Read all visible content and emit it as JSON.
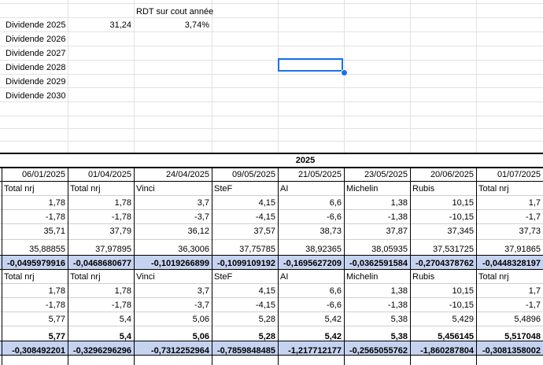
{
  "header": {
    "rdt_label": "RDT sur cout année"
  },
  "dividends": [
    {
      "label": "Dividende 2025",
      "value": "31,24",
      "rdt": "3,74%"
    },
    {
      "label": "Dividende 2026"
    },
    {
      "label": "Dividende 2027"
    },
    {
      "label": "Dividende 2028"
    },
    {
      "label": "Dividende 2029"
    },
    {
      "label": "Dividende 2030"
    }
  ],
  "year": "2025",
  "dates": [
    "06/01/2025",
    "01/04/2025",
    "24/04/2025",
    "09/05/2025",
    "21/05/2025",
    "23/05/2025",
    "20/06/2025",
    "01/07/2025"
  ],
  "block1": {
    "names": [
      "Total nrj",
      "Total nrj",
      "Vinci",
      "SteF",
      "AI",
      "Michelin",
      "Rubis",
      "Total nrj"
    ],
    "row_a": [
      "1,78",
      "1,78",
      "3,7",
      "4,15",
      "6,6",
      "1,38",
      "10,15",
      "1,7"
    ],
    "row_b": [
      "-1,78",
      "-1,78",
      "-3,7",
      "-4,15",
      "-6,6",
      "-1,38",
      "-10,15",
      "-1,7"
    ],
    "row_c": [
      "35,71",
      "37,79",
      "36,12",
      "37,57",
      "38,73",
      "37,87",
      "37,345",
      "37,73"
    ],
    "row_d": [
      "35,88855",
      "37,97895",
      "36,3006",
      "37,75785",
      "38,92365",
      "38,05935",
      "37,531725",
      "37,91865"
    ],
    "row_e": [
      "-0,0495979916",
      "-0,0468680677",
      "-0,1019266899",
      "-0,1099109192",
      "-0,1695627209",
      "-0,0362591584",
      "-0,2704378762",
      "-0,0448328197"
    ]
  },
  "block2": {
    "names": [
      "Total nrj",
      "Total nrj",
      "Vinci",
      "SteF",
      "AI",
      "Michelin",
      "Rubis",
      "Total nrj"
    ],
    "row_a": [
      "1,78",
      "1,78",
      "3,7",
      "4,15",
      "6,6",
      "1,38",
      "10,15",
      "1,7"
    ],
    "row_b": [
      "-1,78",
      "-1,78",
      "-3,7",
      "-4,15",
      "-6,6",
      "-1,38",
      "-10,15",
      "-1,7"
    ],
    "row_c": [
      "5,77",
      "5,4",
      "5,06",
      "5,28",
      "5,42",
      "5,38",
      "5,429",
      "5,4896"
    ],
    "row_d": [
      "5,77",
      "5,4",
      "5,06",
      "5,28",
      "5,42",
      "5,38",
      "5,456145",
      "5,517048"
    ],
    "row_e": [
      "-0,308492201",
      "-0,3296296296",
      "-0,7312252964",
      "-0,7859848485",
      "-1,217712177",
      "-0,2565055762",
      "-1,860287804",
      "-0,3081358002"
    ]
  },
  "colors": {
    "selection": "#1a73e8",
    "band": "#c5d3f0",
    "grid": "#e2e2e2"
  }
}
